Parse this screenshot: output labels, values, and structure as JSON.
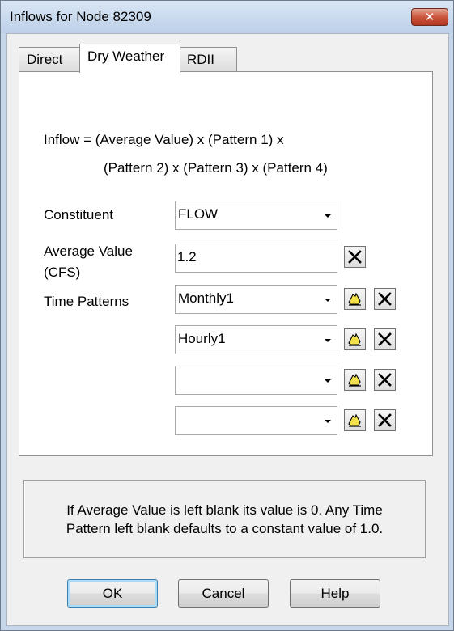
{
  "window": {
    "title": "Inflows for Node 82309",
    "close_glyph": "✕"
  },
  "tabs": [
    {
      "label": "Direct",
      "active": false
    },
    {
      "label": "Dry Weather",
      "active": true
    },
    {
      "label": "RDII",
      "active": false
    }
  ],
  "formula": {
    "line1": "Inflow = (Average Value) x (Pattern 1) x",
    "line2": "(Pattern 2) x (Pattern 3) x (Pattern 4)"
  },
  "constituent": {
    "label": "Constituent",
    "value": "FLOW"
  },
  "average_value": {
    "label_line1": "Average Value",
    "label_line2": "(CFS)",
    "value": "1.2"
  },
  "time_patterns": {
    "label": "Time Patterns",
    "patterns": [
      "Monthly1",
      "Hourly1",
      "",
      ""
    ]
  },
  "info": {
    "line1": "If Average Value is left blank its value is 0. Any Time",
    "line2": "Pattern left blank defaults to a constant value of 1.0."
  },
  "buttons": {
    "ok": "OK",
    "cancel": "Cancel",
    "help": "Help"
  },
  "icons": {
    "edit": "edit-pattern-icon",
    "delete": "delete-x-icon"
  },
  "colors": {
    "title_bar": "#c6d6ea",
    "close_button": "#c9553d",
    "dialog_bg": "#f0f0f0"
  }
}
